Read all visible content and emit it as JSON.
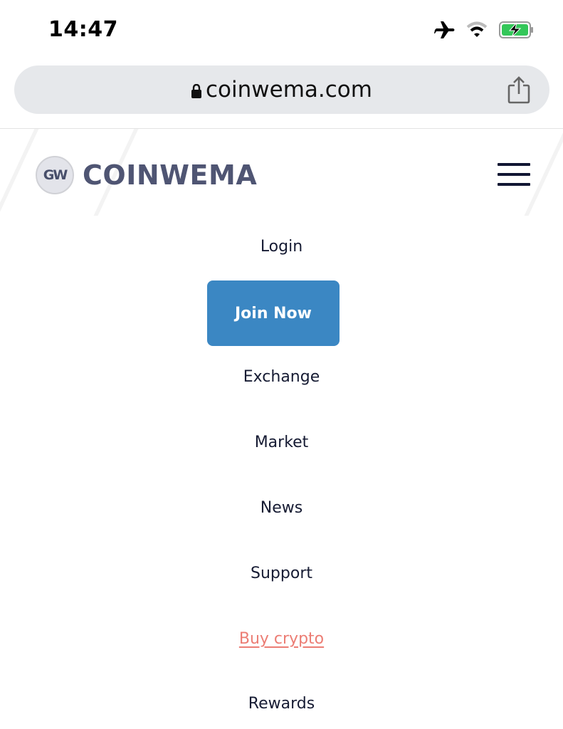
{
  "status_bar": {
    "time": "14:47",
    "icons": [
      "airplane-mode-icon",
      "wifi-icon",
      "battery-charging-icon"
    ],
    "battery_color": "#34c759"
  },
  "browser": {
    "url": "coinwema.com",
    "secure_icon": "lock-icon",
    "share_icon": "share-icon"
  },
  "site": {
    "logo_badge": "GW",
    "brand_name": "COINWEMA",
    "brand_color": "#4f5573",
    "menu_icon": "hamburger-icon"
  },
  "menu": {
    "login": "Login",
    "join_now": "Join Now",
    "join_color": "#3b87c3",
    "items": [
      "Exchange",
      "Market",
      "News",
      "Support",
      "Buy crypto",
      "Rewards"
    ],
    "highlight_color": "#ec7d74"
  }
}
